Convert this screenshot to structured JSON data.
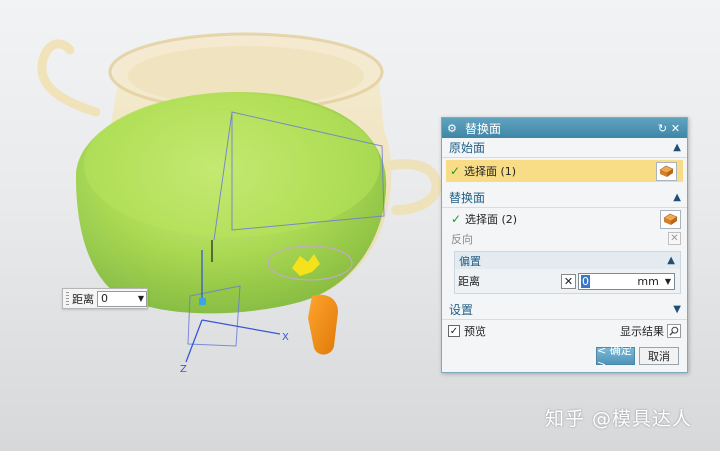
{
  "viewport": {
    "axis_x_label": "X",
    "axis_z_label": "Z",
    "floating_input": {
      "label": "距离",
      "value": "0"
    }
  },
  "dialog": {
    "title": "替换面",
    "original_face": {
      "header": "原始面",
      "select_label": "选择面 (1)"
    },
    "replace_face": {
      "header": "替换面",
      "select_label": "选择面 (2)",
      "reverse_label": "反向",
      "offset": {
        "header": "偏置",
        "distance_label": "距离",
        "distance_value": "0",
        "unit": "mm"
      }
    },
    "settings": {
      "header": "设置"
    },
    "preview_label": "预览",
    "show_result_label": "显示结果",
    "ok_label": "< 确定 >",
    "cancel_label": "取消"
  },
  "watermark": "知乎 @模具达人",
  "colors": {
    "titlebar": "#4a92b2",
    "selection_highlight": "#f8dc86",
    "section_text": "#1f5f86",
    "model_body": "#f3e3b4",
    "model_green": "#a6d94a",
    "model_orange": "#f08c17"
  },
  "icons": {
    "settings": "gear-icon",
    "reset": "refresh-icon",
    "close": "close-icon",
    "face_select": "face-select-icon",
    "checkmark": "check-icon",
    "collapse": "chevron-up-icon",
    "expand": "chevron-down-icon",
    "search": "magnifier-icon"
  }
}
